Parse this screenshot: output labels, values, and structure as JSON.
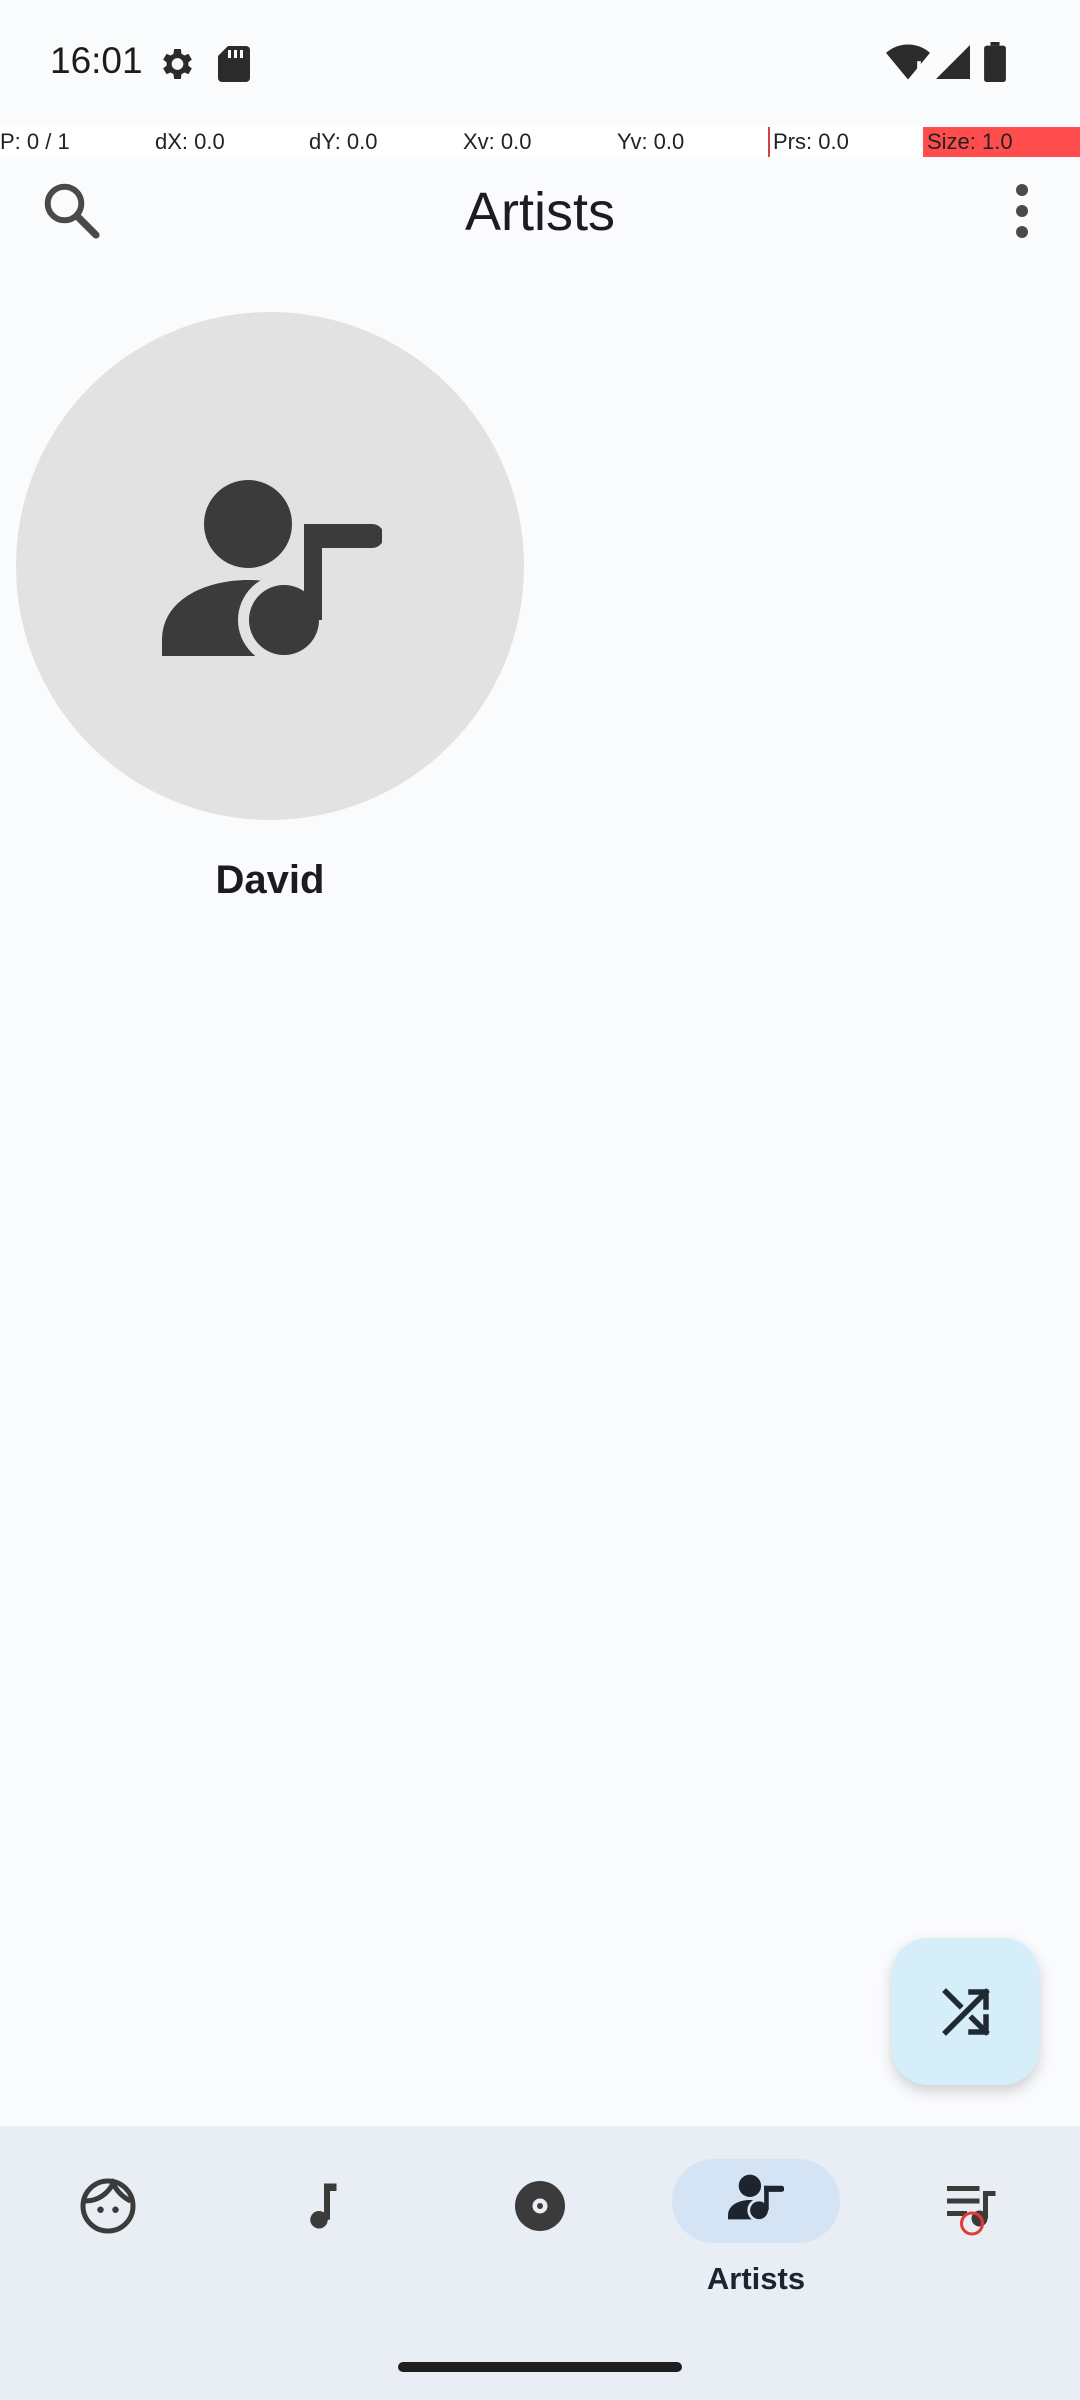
{
  "status_bar": {
    "time": "16:01",
    "icons": [
      "gear-icon",
      "sd-card-icon",
      "wifi-icon",
      "cell-signal-icon",
      "battery-icon"
    ]
  },
  "pointer_overlay": {
    "p": "P: 0 / 1",
    "dx": "dX: 0.0",
    "dy": "dY: 0.0",
    "xv": "Xv: 0.0",
    "yv": "Yv: 0.0",
    "prs": "Prs: 0.0",
    "size": "Size: 1.0"
  },
  "app_bar": {
    "title": "Artists",
    "left_icon": "search-icon",
    "right_icon": "more-vert-icon"
  },
  "artists": [
    {
      "name": "David",
      "icon": "artist-icon"
    }
  ],
  "fab": {
    "icon": "shuffle-icon"
  },
  "bottom_nav": {
    "items": [
      {
        "id": "for-you",
        "icon": "face-icon"
      },
      {
        "id": "songs",
        "icon": "music-note-icon"
      },
      {
        "id": "albums",
        "icon": "album-icon"
      },
      {
        "id": "artists",
        "icon": "artist-icon",
        "label": "Artists",
        "selected": true
      },
      {
        "id": "playlists",
        "icon": "playlist-icon"
      }
    ]
  },
  "colors": {
    "background": "#fafbfd",
    "nav_background": "#e9edf4",
    "nav_pill": "#d4e4f4",
    "fab_background": "#d6eefa",
    "avatar_background": "#e2e2e2",
    "overlay_red": "#ff4d4d"
  }
}
